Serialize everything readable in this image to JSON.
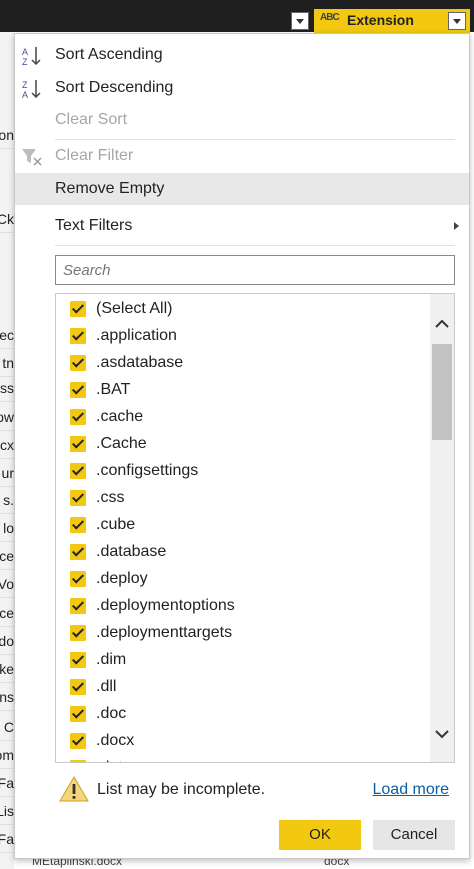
{
  "background": {
    "column_header_label": "Extension",
    "column_type_icon": "ABC",
    "left_cells": [
      "on",
      "Ck",
      "ec",
      "tn",
      "ess",
      "ow",
      "ocx",
      "ur",
      "s.",
      "lo",
      "ce",
      "Vo",
      "ce",
      "do",
      "ke",
      "ns",
      "C",
      "om",
      "Fa",
      "Lis",
      "Fa"
    ],
    "bottom_row": {
      "col1": "MEtaplinski.docx",
      "col2": "docx"
    }
  },
  "menu": {
    "sort_ascending": "Sort Ascending",
    "sort_descending": "Sort Descending",
    "clear_sort": "Clear Sort",
    "clear_filter": "Clear Filter",
    "remove_empty": "Remove Empty",
    "text_filters": "Text Filters"
  },
  "search": {
    "placeholder": "Search"
  },
  "items": [
    "(Select All)",
    ".application",
    ".asdatabase",
    ".BAT",
    ".cache",
    ".Cache",
    ".configsettings",
    ".css",
    ".cube",
    ".database",
    ".deploy",
    ".deploymentoptions",
    ".deploymenttargets",
    ".dim",
    ".dll",
    ".doc",
    ".docx",
    ".dotx"
  ],
  "footer": {
    "warning": "List may be incomplete.",
    "load_more": "Load more",
    "ok": "OK",
    "cancel": "Cancel"
  },
  "colors": {
    "accent": "#f2c811",
    "link": "#0b5fa5"
  }
}
